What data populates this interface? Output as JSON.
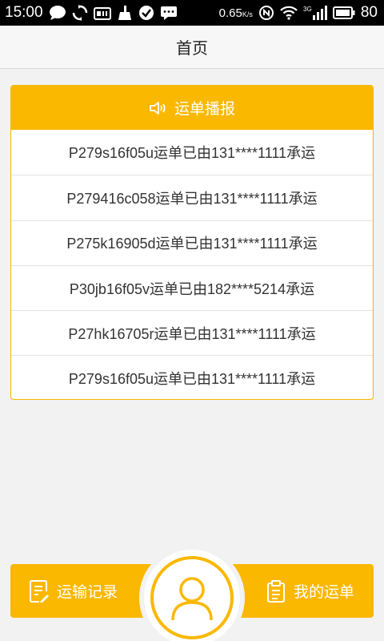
{
  "status_bar": {
    "time": "15:00",
    "speed": "0.65",
    "speed_unit": "K/s",
    "network": "3G",
    "battery": "80",
    "icons": [
      "chat-icon",
      "sync-icon",
      "sd-card-icon",
      "broom-icon",
      "check-icon",
      "message-icon",
      "nfc-icon",
      "wifi-icon",
      "signal-icon",
      "battery-icon"
    ]
  },
  "header": {
    "title": "首页"
  },
  "broadcast": {
    "title": "运单播报",
    "icon": "speaker-icon",
    "items": [
      "P279s16f05u运单已由131****1111承运",
      "P279416c058运单已由131****1111承运",
      "P275k16905d运单已由131****1111承运",
      "P30jb16f05v运单已由182****5214承运",
      "P27hk16705r运单已由131****1111承运",
      "P279s16f05u运单已由131****1111承运"
    ]
  },
  "bottom_nav": {
    "left_label": "运输记录",
    "left_icon": "record-icon",
    "right_label": "我的运单",
    "right_icon": "clipboard-icon",
    "center_icon": "user-icon"
  },
  "colors": {
    "accent": "#fbb800",
    "background": "#f2f2f2"
  }
}
